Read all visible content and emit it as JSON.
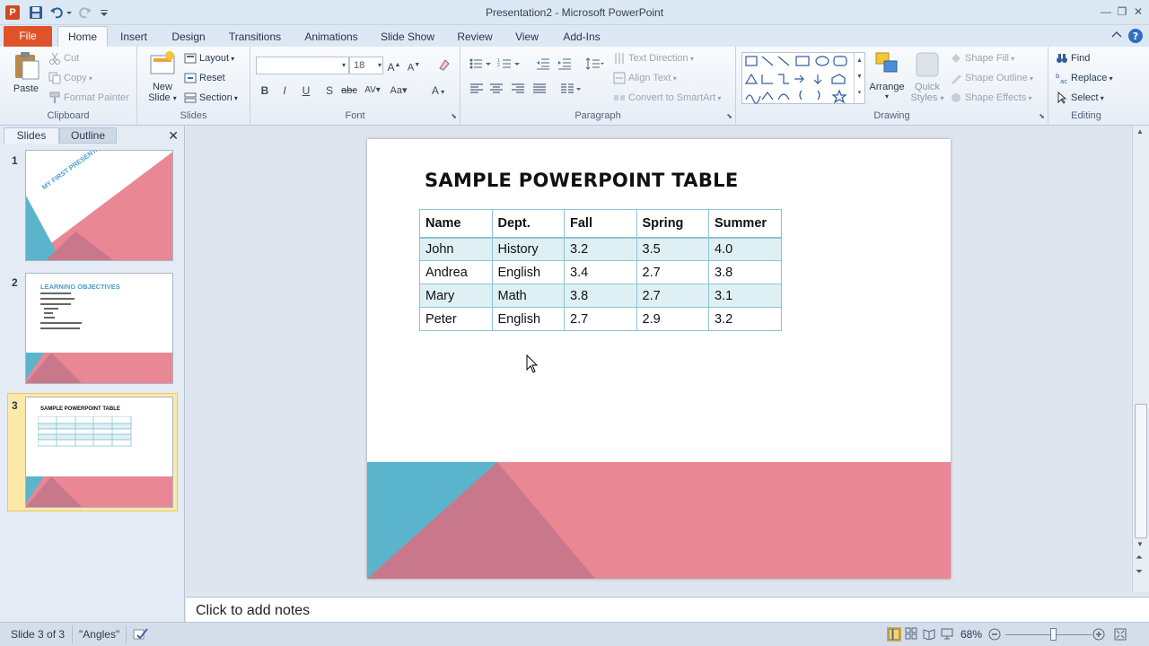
{
  "window": {
    "title": "Presentation2 - Microsoft PowerPoint",
    "app_letter": "P",
    "controls": {
      "minimize": "—",
      "restore": "❐",
      "close": "✕"
    }
  },
  "tabs": [
    "File",
    "Home",
    "Insert",
    "Design",
    "Transitions",
    "Animations",
    "Slide Show",
    "Review",
    "View",
    "Add-Ins"
  ],
  "active_tab": "Home",
  "ribbon": {
    "clipboard": {
      "label": "Clipboard",
      "paste": "Paste",
      "cut": "Cut",
      "copy": "Copy",
      "format_painter": "Format Painter"
    },
    "slides": {
      "label": "Slides",
      "new_slide_line1": "New",
      "new_slide_line2": "Slide",
      "layout": "Layout",
      "reset": "Reset",
      "section": "Section"
    },
    "font": {
      "label": "Font",
      "font_name": "",
      "font_size": "18"
    },
    "paragraph": {
      "label": "Paragraph",
      "text_direction": "Text Direction",
      "align_text": "Align Text",
      "convert_smartart": "Convert to SmartArt"
    },
    "drawing": {
      "label": "Drawing",
      "arrange": "Arrange",
      "quick_styles_line1": "Quick",
      "quick_styles_line2": "Styles",
      "shape_fill": "Shape Fill",
      "shape_outline": "Shape Outline",
      "shape_effects": "Shape Effects"
    },
    "editing": {
      "label": "Editing",
      "find": "Find",
      "replace": "Replace",
      "select": "Select"
    }
  },
  "left_pane": {
    "tab_slides": "Slides",
    "tab_outline": "Outline",
    "thumbnails": [
      {
        "number": "1",
        "title": "MY FIRST PRESENTATION"
      },
      {
        "number": "2",
        "title": "LEARNING OBJECTIVES"
      },
      {
        "number": "3",
        "title": "SAMPLE POWERPOINT TABLE"
      }
    ]
  },
  "slide": {
    "title": "SAMPLE POWERPOINT TABLE",
    "table": {
      "headers": [
        "Name",
        "Dept.",
        "Fall",
        "Spring",
        "Summer"
      ],
      "rows": [
        [
          "John",
          "History",
          "3.2",
          "3.5",
          "4.0"
        ],
        [
          "Andrea",
          "English",
          "3.4",
          "2.7",
          "3.8"
        ],
        [
          "Mary",
          "Math",
          "3.8",
          "2.7",
          "3.1"
        ],
        [
          "Peter",
          "English",
          "2.7",
          "2.9",
          "3.2"
        ]
      ]
    }
  },
  "notes": {
    "placeholder": "Click to add notes"
  },
  "status": {
    "slide_counter": "Slide 3 of 3",
    "theme": "\"Angles\"",
    "zoom": "68%",
    "zoom_fraction": 0.56
  },
  "colors": {
    "teal": "#5ab4cc",
    "pink": "#ea8795",
    "mauve": "#c8788a",
    "file_tab": "#e0522a",
    "table_band": "#dff0f5",
    "table_border": "#8cc4d2"
  }
}
